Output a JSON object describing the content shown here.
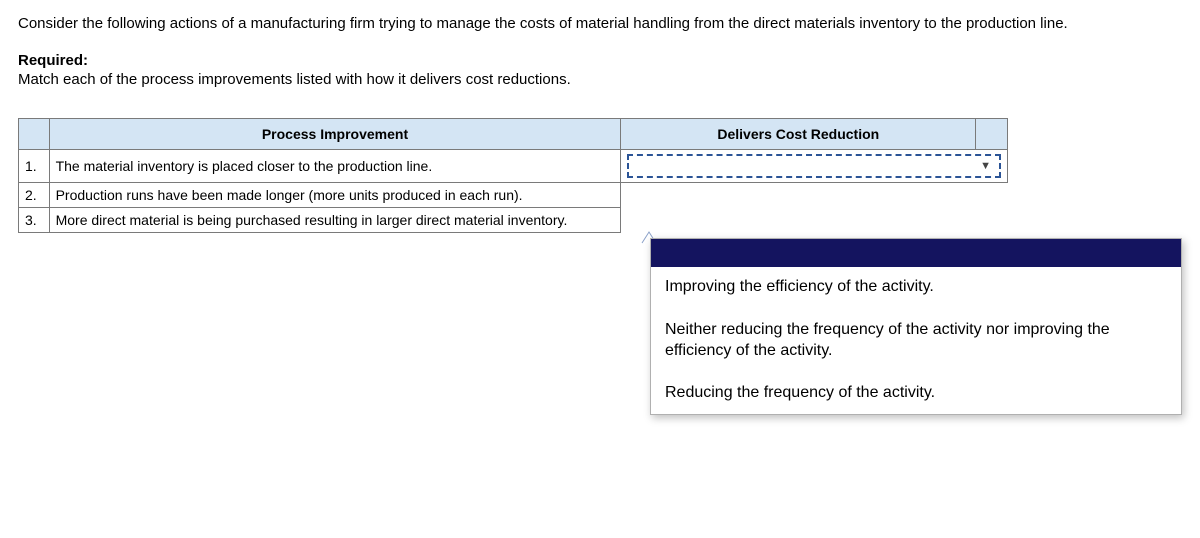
{
  "intro": "Consider the following actions of a manufacturing firm trying to manage the costs of material handling from the direct materials inventory to the production line.",
  "required_label": "Required:",
  "instruction": "Match each of the process improvements listed with how it delivers cost reductions.",
  "table": {
    "headers": {
      "process": "Process Improvement",
      "delivers": "Delivers Cost Reduction"
    },
    "rows": [
      {
        "num": "1.",
        "text": "The material inventory is placed closer to the production line."
      },
      {
        "num": "2.",
        "text": "Production runs have been made longer (more units produced in each run)."
      },
      {
        "num": "3.",
        "text": "More direct material is being purchased resulting in larger direct material inventory."
      }
    ]
  },
  "dropdown": {
    "selected": "",
    "options": [
      "Improving the efficiency of the activity.",
      "Neither reducing the frequency of the activity nor improving the efficiency of the activity.",
      "Reducing the frequency of the activity."
    ]
  }
}
